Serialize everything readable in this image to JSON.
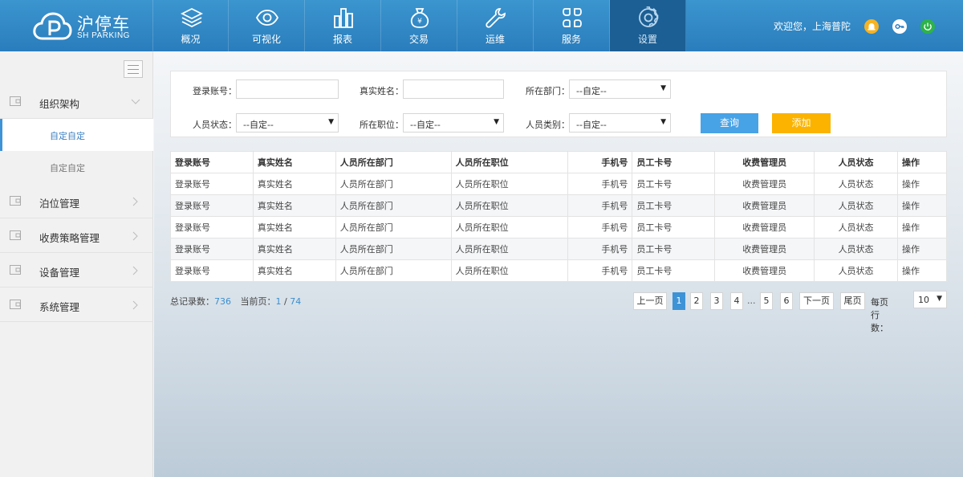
{
  "brand": {
    "name": "沪停车",
    "sub": "SH PARKING"
  },
  "nav": [
    {
      "label": "概况",
      "icon": "layers-icon"
    },
    {
      "label": "可视化",
      "icon": "eye-icon"
    },
    {
      "label": "报表",
      "icon": "bar-chart-icon"
    },
    {
      "label": "交易",
      "icon": "money-bag-icon"
    },
    {
      "label": "运维",
      "icon": "wrench-icon"
    },
    {
      "label": "服务",
      "icon": "grid-icon"
    },
    {
      "label": "设置",
      "icon": "gear-icon"
    }
  ],
  "nav_active": "设置",
  "header": {
    "welcome": "欢迎您，上海普陀"
  },
  "header_icons": [
    {
      "name": "notification-icon",
      "color": "#f5b324"
    },
    {
      "name": "key-icon",
      "color": "#2a80c6"
    },
    {
      "name": "power-icon",
      "color": "#2db34a"
    }
  ],
  "sidebar": {
    "groups": [
      {
        "label": "组织架构"
      },
      {
        "label": "泊位管理"
      },
      {
        "label": "收费策略管理"
      },
      {
        "label": "设备管理"
      },
      {
        "label": "系统管理"
      }
    ],
    "sub_items": [
      {
        "label": "自定自定",
        "active": true
      },
      {
        "label": "自定自定",
        "active": false
      }
    ]
  },
  "filter": {
    "login_label": "登录账号：",
    "name_label": "真实姓名：",
    "dept_label": "所在部门：",
    "dept_value": "--自定--",
    "status_label": "人员状态：",
    "status_value": "--自定--",
    "position_label": "所在职位：",
    "position_value": "--自定--",
    "type_label": "人员类别：",
    "type_value": "--自定--",
    "query_label": "查询",
    "add_label": "添加"
  },
  "colors": {
    "primary": "#3d93d6",
    "add": "#fbb300",
    "header": "#2a7dbc"
  },
  "table": {
    "headers": [
      "登录账号",
      "真实姓名",
      "人员所在部门",
      "人员所在职位",
      "手机号",
      "员工卡号",
      "收费管理员",
      "人员状态",
      "操作"
    ],
    "rows": [
      [
        "登录账号",
        "真实姓名",
        "人员所在部门",
        "人员所在职位",
        "手机号",
        "员工卡号",
        "收费管理员",
        "人员状态",
        "操作"
      ],
      [
        "登录账号",
        "真实姓名",
        "人员所在部门",
        "人员所在职位",
        "手机号",
        "员工卡号",
        "收费管理员",
        "人员状态",
        "操作"
      ],
      [
        "登录账号",
        "真实姓名",
        "人员所在部门",
        "人员所在职位",
        "手机号",
        "员工卡号",
        "收费管理员",
        "人员状态",
        "操作"
      ],
      [
        "登录账号",
        "真实姓名",
        "人员所在部门",
        "人员所在职位",
        "手机号",
        "员工卡号",
        "收费管理员",
        "人员状态",
        "操作"
      ],
      [
        "登录账号",
        "真实姓名",
        "人员所在部门",
        "人员所在职位",
        "手机号",
        "员工卡号",
        "收费管理员",
        "人员状态",
        "操作"
      ]
    ]
  },
  "summary": {
    "total_label": "总记录数：",
    "total": "736",
    "page_label": "当前页：",
    "current": "1",
    "sep": " / ",
    "pages": "74"
  },
  "pager": {
    "prev": "上一页",
    "pages": [
      "1",
      "2",
      "3",
      "4"
    ],
    "dots": "...",
    "pages2": [
      "5",
      "6"
    ],
    "next": "下一页",
    "last": "尾页",
    "per_page_label": "每页行数：",
    "per_page_value": "10"
  }
}
